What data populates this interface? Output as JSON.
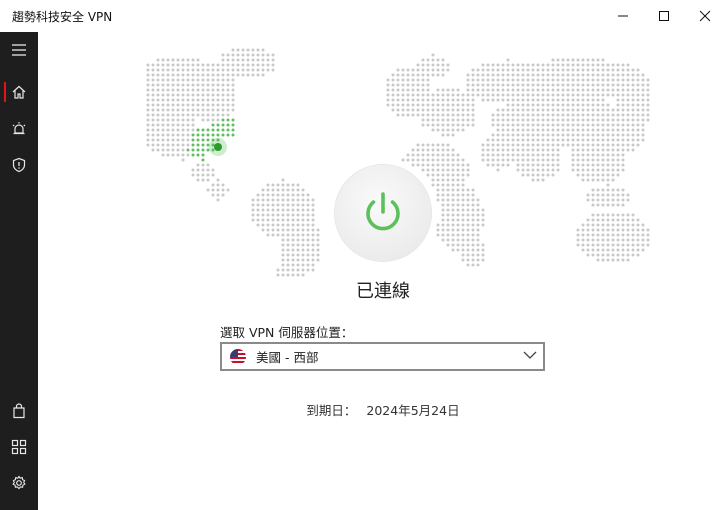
{
  "window": {
    "title": "趨勢科技安全 VPN"
  },
  "sidebar": {
    "items": [
      {
        "name": "menu",
        "icon": "hamburger-icon"
      },
      {
        "name": "home",
        "icon": "home-icon",
        "active": true
      },
      {
        "name": "alerts",
        "icon": "bell-icon"
      },
      {
        "name": "protection",
        "icon": "shield-icon"
      },
      {
        "name": "store",
        "icon": "shopping-bag-icon"
      },
      {
        "name": "apps",
        "icon": "grid-icon"
      },
      {
        "name": "settings",
        "icon": "gear-icon"
      }
    ]
  },
  "main": {
    "status": "已連線",
    "location_label": "選取 VPN 伺服器位置：",
    "selected_location": "美國 - 西部",
    "expiry_label": "到期日：",
    "expiry_date": "2024年5月24日"
  },
  "colors": {
    "accent_green": "#5cc05c",
    "active_red": "#e3141c",
    "sidebar": "#1e1e1e",
    "map_dot": "#c9c9c9"
  }
}
